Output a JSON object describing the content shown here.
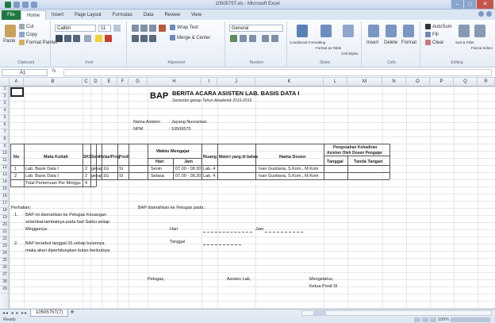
{
  "window": {
    "title": "1050575T.xls - Microsoft Excel"
  },
  "ribbon": {
    "file_tab": "File",
    "tabs": [
      "Home",
      "Insert",
      "Page Layout",
      "Formulas",
      "Data",
      "Review",
      "View"
    ],
    "clipboard": {
      "paste": "Paste",
      "cut": "Cut",
      "copy": "Copy",
      "format_painter": "Format Painter",
      "label": "Clipboard"
    },
    "font": {
      "name": "Calibri",
      "size": "11",
      "label": "Font"
    },
    "alignment": {
      "wrap_text": "Wrap Text",
      "merge": "Merge & Center",
      "label": "Alignment"
    },
    "number": {
      "format": "General",
      "label": "Number"
    },
    "styles": {
      "conditional": "Conditional Formatting",
      "format_table": "Format as Table",
      "cell_styles": "Cell Styles",
      "label": "Styles"
    },
    "cells": {
      "insert": "Insert",
      "delete": "Delete",
      "format": "Format",
      "label": "Cells"
    },
    "editing": {
      "autosum": "AutoSum",
      "fill": "Fill",
      "clear": "Clear",
      "sort": "Sort & Filter",
      "find": "Find & Select",
      "label": "Editing"
    }
  },
  "formula_bar": {
    "name_box": "A1",
    "fx": "fx",
    "value": ""
  },
  "columns": [
    "A",
    "B",
    "C",
    "D",
    "E",
    "F",
    "G",
    "H",
    "I",
    "J",
    "K",
    "L",
    "M",
    "N",
    "O",
    "P",
    "Q",
    "R"
  ],
  "rows": [
    "1",
    "2",
    "3",
    "4",
    "5",
    "6",
    "7",
    "8",
    "9",
    "10",
    "11",
    "12",
    "13",
    "14",
    "15",
    "16",
    "17",
    "18",
    "19",
    "20",
    "21",
    "22",
    "23",
    "24",
    "25",
    "26",
    "27",
    "28",
    "29"
  ],
  "doc": {
    "bap": "BAP",
    "heading": "BERITA ACARA ASISTEN LAB. BASIS DATA I",
    "subheading": "Semester genap Tahun Akademik 2015-2016",
    "nama_asisten_label": "Nama Asisten",
    "nama_asisten_value": ": Jayang Nurzaman",
    "npm_label": "NPM",
    "npm_value": ": 10509575",
    "table": {
      "h_no": "No",
      "h_mata_kuliah": "Mata Kuliah",
      "h_sks": "SKS",
      "h_sem": "Sem",
      "h_kelas": "Kelas/Prog",
      "h_prodi": "Prodi",
      "h_waktu": "Waktu Mengajar",
      "h_hari": "Hari",
      "h_jam": "Jam",
      "h_ruang": "Ruang",
      "h_materi": "Materi yang di bahas",
      "h_dosen": "Nama Dosen",
      "h_pengesahan": "Pengesahan Kehadiran",
      "h_pengesahan2": "Asisten Oleh Dosen Pengajar",
      "h_tanggal": "Tanggal",
      "h_ttd": "Tanda Tangan",
      "rows": [
        {
          "no": "1",
          "mk": "Lab. Basis Data I",
          "sks": "2",
          "sem": "genap",
          "kelas": "1G",
          "prodi": "SI",
          "hari": "Senin",
          "jam": "07.00 - 08.30",
          "ruang": "Lab. 4",
          "dosen": "Ivan Gustiana, S.Kom., M.Kom"
        },
        {
          "no": "2",
          "mk": "Lab. Basis Data I",
          "sks": "2",
          "sem": "genap",
          "kelas": "1G",
          "prodi": "SI",
          "hari": "Selasa",
          "jam": "07.00 - 08.30",
          "ruang": "Lab. 4",
          "dosen": "Ivan Gustiana, S.Kom., M.Kom"
        }
      ],
      "total_label": "Total Pertemuan Per Minggu",
      "total_value": "4"
    },
    "perhatian": "Perhatian:",
    "note1_no": "1.",
    "note1_a": "BAP ini diserahkan ke Petugas Keuangan",
    "note1_b": "selambat-lambatnya pada hari Sabtu setiap",
    "note1_c": "Minggunya",
    "note2_no": "2.",
    "note2_a": "BAP tersebut tanggal 26 setiap bulannya",
    "note2_b": "maka akan diperhitungkan bulan berikutnya",
    "diserahkan": "BAP diserahkan ke Petugas pada :",
    "hari_label": "Hari",
    "jam_label": "Jam",
    "tanggal_label": "Tanggal",
    "petugas": "Petugas,",
    "asisten": "Asisten Lab,",
    "mengetahui": "Mengetahui,",
    "ketua": "Ketua Prodi SI"
  },
  "sheet": {
    "tab": "1050575T(7)",
    "nav": "◂◂ ◂ ▸ ▸▸"
  },
  "status": {
    "ready": "Ready",
    "zoom": "100%"
  }
}
